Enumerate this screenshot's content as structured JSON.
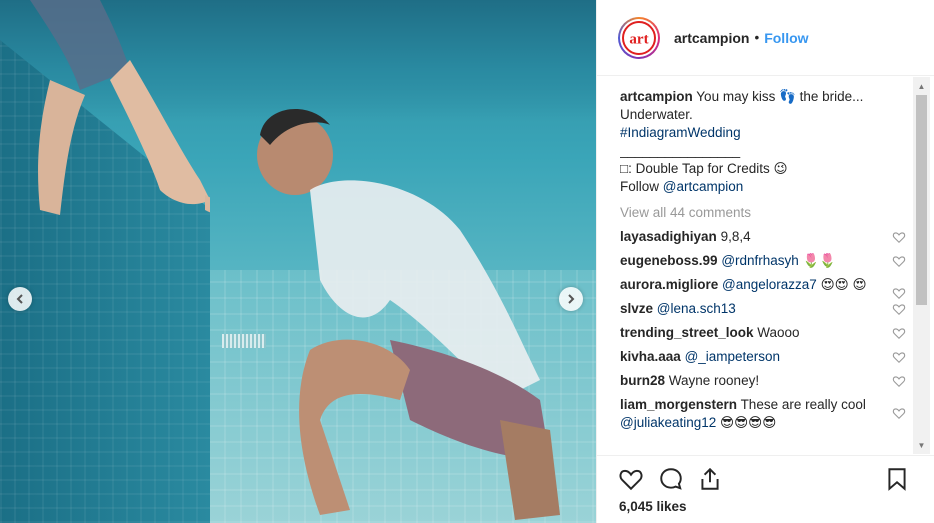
{
  "post": {
    "username": "artcampion",
    "follow_label": "Follow",
    "separator": "•",
    "logo_text": "art"
  },
  "caption": {
    "username": "artcampion",
    "line1": "You may kiss 👣 the bride...",
    "line2": "Underwater.",
    "hashtag": "#IndiagramWedding",
    "divider": "________________",
    "credits": "□: Double Tap for Credits 😉",
    "follow_text": "Follow ",
    "follow_handle": "@artcampion"
  },
  "view_all_label": "View all 44 comments",
  "comments": [
    {
      "user": "layasadighiyan",
      "text": "9,8,4",
      "mention": ""
    },
    {
      "user": "eugeneboss.99",
      "text": " 🌷🌷",
      "mention": "@rdnfrhasyh"
    },
    {
      "user": "aurora.migliore",
      "text": " 😍😍 😍",
      "mention": "@angelorazza7"
    },
    {
      "user": "slvze",
      "text": "",
      "mention": "@lena.sch13"
    },
    {
      "user": "trending_street_look",
      "text": "Waooo",
      "mention": ""
    },
    {
      "user": "kivha.aaa",
      "text": "",
      "mention": "@_iampeterson"
    },
    {
      "user": "burn28",
      "text": "Wayne rooney!",
      "mention": ""
    },
    {
      "user": "liam_morgenstern",
      "text": "These are really cool ",
      "mention": "@juliakeating12",
      "suffix": " 😎😎😎😎"
    }
  ],
  "likes_label": "6,045 likes",
  "icons": {
    "heart": "heart-icon",
    "comment": "comment-icon",
    "share": "share-icon",
    "bookmark": "bookmark-icon",
    "nav_left": "chevron-left-icon",
    "nav_right": "chevron-right-icon"
  },
  "colors": {
    "link_blue": "#3897f0",
    "hashtag_navy": "#003569",
    "muted": "#999999",
    "logo_red": "#e02020"
  }
}
